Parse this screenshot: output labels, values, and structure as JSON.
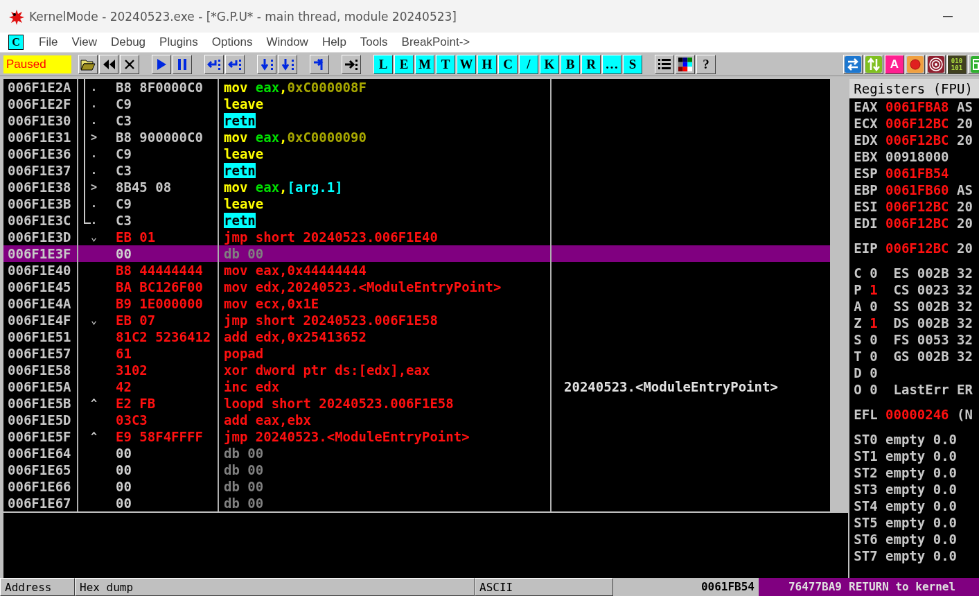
{
  "window": {
    "title": "KernelMode - 20240523.exe - [*G.P.U* - main thread, module 20240523]"
  },
  "menu": {
    "badge": "C",
    "items": [
      "File",
      "View",
      "Debug",
      "Plugins",
      "Options",
      "Window",
      "Help",
      "Tools",
      "BreakPoint->"
    ]
  },
  "toolbar": {
    "status": "Paused",
    "button_groups": [
      [
        {
          "kind": "open"
        },
        {
          "kind": "rewind"
        },
        {
          "kind": "close"
        }
      ],
      [
        {
          "kind": "run"
        },
        {
          "kind": "pause"
        }
      ],
      [
        {
          "kind": "step-in"
        },
        {
          "kind": "step-over"
        }
      ],
      [
        {
          "kind": "trace-in"
        },
        {
          "kind": "trace-over"
        }
      ],
      [
        {
          "kind": "return"
        }
      ],
      [
        {
          "kind": "goto"
        }
      ],
      [
        {
          "kind": "letter",
          "label": "L"
        },
        {
          "kind": "letter",
          "label": "E"
        },
        {
          "kind": "letter",
          "label": "M"
        },
        {
          "kind": "letter",
          "label": "T"
        },
        {
          "kind": "letter",
          "label": "W"
        },
        {
          "kind": "letter",
          "label": "H"
        },
        {
          "kind": "letter",
          "label": "C"
        },
        {
          "kind": "letter",
          "label": "/"
        },
        {
          "kind": "letter",
          "label": "K"
        },
        {
          "kind": "letter",
          "label": "B"
        },
        {
          "kind": "letter",
          "label": "R"
        },
        {
          "kind": "letter",
          "label": "…"
        },
        {
          "kind": "letter",
          "label": "S"
        }
      ],
      [
        {
          "kind": "list"
        },
        {
          "kind": "palette"
        },
        {
          "kind": "text",
          "label": "?"
        }
      ]
    ],
    "right_buttons": [
      {
        "kind": "swap"
      },
      {
        "kind": "updown"
      },
      {
        "kind": "pink-letter",
        "label": "A"
      },
      {
        "kind": "record"
      },
      {
        "kind": "target"
      },
      {
        "kind": "binary",
        "label": "010 101"
      },
      {
        "kind": "window"
      }
    ]
  },
  "disassembly": {
    "rows": [
      {
        "address": "006F1E2A",
        "bracket": true,
        "bracket_end": false,
        "marker": ".",
        "hex": "B8 8F0000C0",
        "kind": "normal",
        "selected": false,
        "tokens": [
          {
            "text": "mov ",
            "kind": "op"
          },
          {
            "text": "eax",
            "kind": "reg"
          },
          {
            "text": ",",
            "kind": "op"
          },
          {
            "text": "0xC000008F",
            "kind": "num"
          }
        ]
      },
      {
        "address": "006F1E2F",
        "bracket": true,
        "bracket_end": false,
        "marker": ".",
        "hex": "C9",
        "kind": "normal",
        "selected": false,
        "tokens": [
          {
            "text": "leave",
            "kind": "op"
          }
        ]
      },
      {
        "address": "006F1E30",
        "bracket": true,
        "bracket_end": false,
        "marker": ".",
        "hex": "C3",
        "kind": "normal",
        "selected": false,
        "tokens": [
          {
            "text": "retn",
            "kind": "ret"
          }
        ]
      },
      {
        "address": "006F1E31",
        "bracket": true,
        "bracket_end": false,
        "marker": ">",
        "hex": "B8 900000C0",
        "kind": "normal",
        "selected": false,
        "tokens": [
          {
            "text": "mov ",
            "kind": "op"
          },
          {
            "text": "eax",
            "kind": "reg"
          },
          {
            "text": ",",
            "kind": "op"
          },
          {
            "text": "0xC0000090",
            "kind": "num"
          }
        ]
      },
      {
        "address": "006F1E36",
        "bracket": true,
        "bracket_end": false,
        "marker": ".",
        "hex": "C9",
        "kind": "normal",
        "selected": false,
        "tokens": [
          {
            "text": "leave",
            "kind": "op"
          }
        ]
      },
      {
        "address": "006F1E37",
        "bracket": true,
        "bracket_end": false,
        "marker": ".",
        "hex": "C3",
        "kind": "normal",
        "selected": false,
        "tokens": [
          {
            "text": "retn",
            "kind": "ret"
          }
        ]
      },
      {
        "address": "006F1E38",
        "bracket": true,
        "bracket_end": false,
        "marker": ">",
        "hex": "8B45 08",
        "kind": "normal",
        "selected": false,
        "tokens": [
          {
            "text": "mov ",
            "kind": "op"
          },
          {
            "text": "eax",
            "kind": "reg"
          },
          {
            "text": ",",
            "kind": "op"
          },
          {
            "text": "[arg.1]",
            "kind": "mem"
          }
        ]
      },
      {
        "address": "006F1E3B",
        "bracket": true,
        "bracket_end": false,
        "marker": ".",
        "hex": "C9",
        "kind": "normal",
        "selected": false,
        "tokens": [
          {
            "text": "leave",
            "kind": "op"
          }
        ]
      },
      {
        "address": "006F1E3C",
        "bracket": true,
        "bracket_end": true,
        "marker": ".",
        "hex": "C3",
        "kind": "normal",
        "selected": false,
        "tokens": [
          {
            "text": "retn",
            "kind": "ret"
          }
        ]
      },
      {
        "address": "006F1E3D",
        "bracket": false,
        "bracket_end": false,
        "marker": "⌄",
        "hex": "EB 01",
        "kind": "patched",
        "selected": false,
        "tokens": [
          {
            "text": "jmp short 20240523.006F1E40",
            "kind": "patched"
          }
        ]
      },
      {
        "address": "006F1E3F",
        "bracket": false,
        "bracket_end": false,
        "hex": "00",
        "kind": "data",
        "selected": true,
        "tokens": [
          {
            "text": "db 00",
            "kind": "data"
          }
        ]
      },
      {
        "address": "006F1E40",
        "bracket": false,
        "bracket_end": false,
        "hex": "B8 44444444",
        "kind": "patched",
        "selected": false,
        "tokens": [
          {
            "text": "mov eax,0x44444444",
            "kind": "patched"
          }
        ]
      },
      {
        "address": "006F1E45",
        "bracket": false,
        "bracket_end": false,
        "hex": "BA BC126F00",
        "kind": "patched",
        "selected": false,
        "tokens": [
          {
            "text": "mov edx,20240523.<ModuleEntryPoint>",
            "kind": "patched"
          }
        ]
      },
      {
        "address": "006F1E4A",
        "bracket": false,
        "bracket_end": false,
        "hex": "B9 1E000000",
        "kind": "patched",
        "selected": false,
        "tokens": [
          {
            "text": "mov ecx,0x1E",
            "kind": "patched"
          }
        ]
      },
      {
        "address": "006F1E4F",
        "bracket": false,
        "bracket_end": false,
        "marker": "⌄",
        "hex": "EB 07",
        "kind": "patched",
        "selected": false,
        "tokens": [
          {
            "text": "jmp short 20240523.006F1E58",
            "kind": "patched"
          }
        ]
      },
      {
        "address": "006F1E51",
        "bracket": false,
        "bracket_end": false,
        "hex": "81C2 5236412",
        "kind": "patched",
        "selected": false,
        "tokens": [
          {
            "text": "add edx,0x25413652",
            "kind": "patched"
          }
        ]
      },
      {
        "address": "006F1E57",
        "bracket": false,
        "bracket_end": false,
        "hex": "61",
        "kind": "patched",
        "selected": false,
        "tokens": [
          {
            "text": "popad",
            "kind": "patched"
          }
        ]
      },
      {
        "address": "006F1E58",
        "bracket": false,
        "bracket_end": false,
        "hex": "3102",
        "kind": "patched",
        "selected": false,
        "tokens": [
          {
            "text": "xor dword ptr ds:[edx],eax",
            "kind": "patched"
          }
        ]
      },
      {
        "address": "006F1E5A",
        "bracket": false,
        "bracket_end": false,
        "hex": "42",
        "kind": "patched",
        "selected": false,
        "tokens": [
          {
            "text": "inc edx",
            "kind": "patched"
          }
        ],
        "comment": "20240523.<ModuleEntryPoint>"
      },
      {
        "address": "006F1E5B",
        "bracket": false,
        "bracket_end": false,
        "marker": "^",
        "hex": "E2 FB",
        "kind": "patched",
        "selected": false,
        "tokens": [
          {
            "text": "loopd short 20240523.006F1E58",
            "kind": "patched"
          }
        ]
      },
      {
        "address": "006F1E5D",
        "bracket": false,
        "bracket_end": false,
        "hex": "03C3",
        "kind": "patched",
        "selected": false,
        "tokens": [
          {
            "text": "add eax,ebx",
            "kind": "patched"
          }
        ]
      },
      {
        "address": "006F1E5F",
        "bracket": false,
        "bracket_end": false,
        "marker": "^",
        "hex": "E9 58F4FFFF",
        "kind": "patched",
        "selected": false,
        "tokens": [
          {
            "text": "jmp 20240523.<ModuleEntryPoint>",
            "kind": "patched"
          }
        ]
      },
      {
        "address": "006F1E64",
        "bracket": false,
        "bracket_end": false,
        "hex": "00",
        "kind": "data",
        "selected": false,
        "tokens": [
          {
            "text": "db 00",
            "kind": "data"
          }
        ]
      },
      {
        "address": "006F1E65",
        "bracket": false,
        "bracket_end": false,
        "hex": "00",
        "kind": "data",
        "selected": false,
        "tokens": [
          {
            "text": "db 00",
            "kind": "data"
          }
        ]
      },
      {
        "address": "006F1E66",
        "bracket": false,
        "bracket_end": false,
        "hex": "00",
        "kind": "data",
        "selected": false,
        "tokens": [
          {
            "text": "db 00",
            "kind": "data"
          }
        ]
      },
      {
        "address": "006F1E67",
        "bracket": false,
        "bracket_end": false,
        "hex": "00",
        "kind": "data",
        "selected": false,
        "tokens": [
          {
            "text": "db 00",
            "kind": "data"
          }
        ]
      }
    ]
  },
  "registers": {
    "title": "Registers (FPU)",
    "general": [
      {
        "name": "EAX",
        "value": "0061FBA8",
        "changed": true,
        "note": "AS"
      },
      {
        "name": "ECX",
        "value": "006F12BC",
        "changed": true,
        "note": "20"
      },
      {
        "name": "EDX",
        "value": "006F12BC",
        "changed": true,
        "note": "20"
      },
      {
        "name": "EBX",
        "value": "00918000",
        "changed": false
      },
      {
        "name": "ESP",
        "value": "0061FB54",
        "changed": true
      },
      {
        "name": "EBP",
        "value": "0061FB60",
        "changed": true,
        "note": "AS"
      },
      {
        "name": "ESI",
        "value": "006F12BC",
        "changed": true,
        "note": "20"
      },
      {
        "name": "EDI",
        "value": "006F12BC",
        "changed": true,
        "note": "20"
      }
    ],
    "eip": {
      "name": "EIP",
      "value": "006F12BC",
      "changed": true,
      "note": "20"
    },
    "flags": [
      {
        "name": "C",
        "value": "0",
        "changed": false,
        "segment": "ES",
        "selector": "002B",
        "bits": "32"
      },
      {
        "name": "P",
        "value": "1",
        "changed": true,
        "segment": "CS",
        "selector": "0023",
        "bits": "32"
      },
      {
        "name": "A",
        "value": "0",
        "changed": false,
        "segment": "SS",
        "selector": "002B",
        "bits": "32"
      },
      {
        "name": "Z",
        "value": "1",
        "changed": true,
        "segment": "DS",
        "selector": "002B",
        "bits": "32"
      },
      {
        "name": "S",
        "value": "0",
        "changed": false,
        "segment": "FS",
        "selector": "0053",
        "bits": "32"
      },
      {
        "name": "T",
        "value": "0",
        "changed": false,
        "segment": "GS",
        "selector": "002B",
        "bits": "32"
      },
      {
        "name": "D",
        "value": "0",
        "changed": false
      },
      {
        "name": "O",
        "value": "0",
        "changed": false,
        "extra_label": "LastErr",
        "extra_value": "ER"
      }
    ],
    "efl": {
      "name": "EFL",
      "value": "00000246",
      "changed": true,
      "note": "(N"
    },
    "fpu": [
      {
        "name": "ST0",
        "tag": "empty",
        "value": "0.0"
      },
      {
        "name": "ST1",
        "tag": "empty",
        "value": "0.0"
      },
      {
        "name": "ST2",
        "tag": "empty",
        "value": "0.0"
      },
      {
        "name": "ST3",
        "tag": "empty",
        "value": "0.0"
      },
      {
        "name": "ST4",
        "tag": "empty",
        "value": "0.0"
      },
      {
        "name": "ST5",
        "tag": "empty",
        "value": "0.0"
      },
      {
        "name": "ST6",
        "tag": "empty",
        "value": "0.0"
      },
      {
        "name": "ST7",
        "tag": "empty",
        "value": "0.0"
      }
    ]
  },
  "dump": {
    "columns": [
      "Address",
      "Hex dump",
      "ASCII"
    ]
  },
  "stack": {
    "rows": [
      {
        "address": "0061FB54",
        "value": "76477BA9",
        "comment": "RETURN to kernel",
        "selected": true
      }
    ]
  }
}
